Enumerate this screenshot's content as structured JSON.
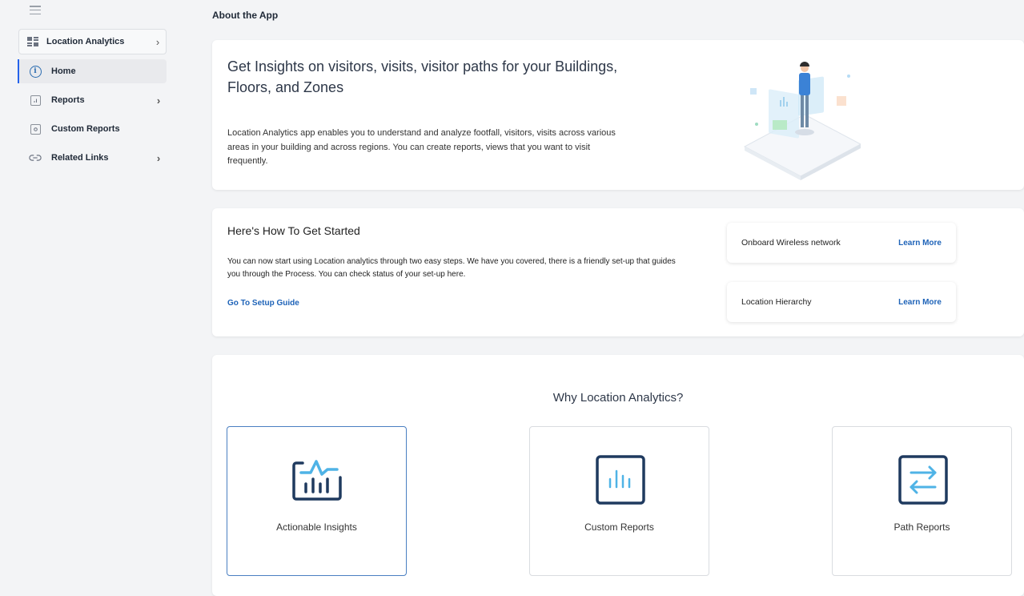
{
  "sidebar": {
    "app_name": "Location Analytics",
    "items": [
      {
        "label": "Home"
      },
      {
        "label": "Reports"
      },
      {
        "label": "Custom Reports"
      },
      {
        "label": "Related Links"
      }
    ]
  },
  "main": {
    "section_title": "About the App",
    "intro": {
      "headline": "Get Insights on visitors, visits, visitor paths for your Buildings, Floors, and Zones",
      "description": "Location Analytics app enables you to understand and analyze footfall, visitors, visits across various areas in your building and across regions. You can create reports, views that you want to visit frequently."
    },
    "get_started": {
      "title": "Here's How To Get Started",
      "description": "You can now start using Location analytics through two easy steps. We have you covered, there is a friendly set-up that guides you through the Process. You can check status of your set-up here.",
      "guide_link": "Go To Setup Guide",
      "steps": [
        {
          "label": "Onboard Wireless network",
          "action": "Learn More"
        },
        {
          "label": "Location Hierarchy",
          "action": "Learn More"
        }
      ]
    },
    "why": {
      "title": "Why Location Analytics?",
      "features": [
        {
          "label": "Actionable Insights",
          "icon": "analytics-chart-icon"
        },
        {
          "label": "Custom Reports",
          "icon": "bar-chart-icon"
        },
        {
          "label": "Path Reports",
          "icon": "swap-arrows-icon"
        }
      ]
    }
  },
  "colors": {
    "accent": "#1e63b8",
    "icon_dark": "#1f3a5f",
    "icon_light": "#4fb3e6"
  }
}
